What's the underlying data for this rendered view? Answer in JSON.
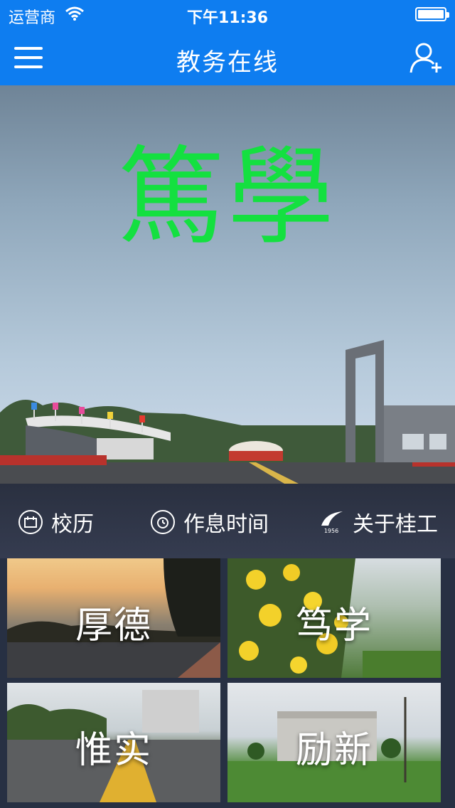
{
  "status_bar": {
    "carrier": "运营商",
    "time": "下午11:36"
  },
  "nav": {
    "title": "教务在线"
  },
  "hero": {
    "title": "篤學"
  },
  "quick_links": [
    {
      "label": "校历",
      "icon": "calendar-icon"
    },
    {
      "label": "作息时间",
      "icon": "alarm-clock-icon"
    },
    {
      "label": "关于桂工",
      "icon": "school-logo-icon",
      "logo_text": "1956"
    }
  ],
  "tiles": [
    {
      "label": "厚德"
    },
    {
      "label": "笃学"
    },
    {
      "label": "惟实"
    },
    {
      "label": "励新"
    }
  ],
  "colors": {
    "accent": "#0e7df0",
    "hero_title": "#14e040"
  }
}
